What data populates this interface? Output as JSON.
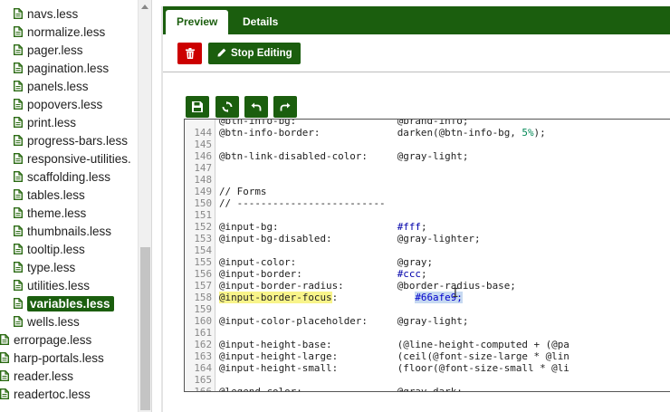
{
  "sidebar": {
    "files": [
      {
        "name": "navs.less",
        "indent": true
      },
      {
        "name": "normalize.less",
        "indent": true
      },
      {
        "name": "pager.less",
        "indent": true
      },
      {
        "name": "pagination.less",
        "indent": true
      },
      {
        "name": "panels.less",
        "indent": true
      },
      {
        "name": "popovers.less",
        "indent": true
      },
      {
        "name": "print.less",
        "indent": true
      },
      {
        "name": "progress-bars.less",
        "indent": true
      },
      {
        "name": "responsive-utilities.",
        "indent": true
      },
      {
        "name": "scaffolding.less",
        "indent": true
      },
      {
        "name": "tables.less",
        "indent": true
      },
      {
        "name": "theme.less",
        "indent": true
      },
      {
        "name": "thumbnails.less",
        "indent": true
      },
      {
        "name": "tooltip.less",
        "indent": true
      },
      {
        "name": "type.less",
        "indent": true
      },
      {
        "name": "utilities.less",
        "indent": true
      },
      {
        "name": "variables.less",
        "indent": true,
        "active": true
      },
      {
        "name": "wells.less",
        "indent": true
      },
      {
        "name": "errorpage.less",
        "indent": false
      },
      {
        "name": "harp-portals.less",
        "indent": false
      },
      {
        "name": "reader.less",
        "indent": false
      },
      {
        "name": "readertoc.less",
        "indent": false
      }
    ]
  },
  "tabs": {
    "preview": "Preview",
    "details": "Details"
  },
  "toolbar": {
    "stop_editing": "Stop Editing"
  },
  "editor": {
    "lines": [
      {
        "n": "",
        "code": "@btn-info-bg:                 @brand-info;"
      },
      {
        "n": "144",
        "code": "@btn-info-border:             darken(@btn-info-bg, 5%);"
      },
      {
        "n": "145",
        "code": ""
      },
      {
        "n": "146",
        "code": "@btn-link-disabled-color:     @gray-light;"
      },
      {
        "n": "147",
        "code": ""
      },
      {
        "n": "148",
        "code": ""
      },
      {
        "n": "149",
        "code": "// Forms"
      },
      {
        "n": "150",
        "code": "// -------------------------"
      },
      {
        "n": "151",
        "code": ""
      },
      {
        "n": "152",
        "code": "@input-bg:                    #fff;"
      },
      {
        "n": "153",
        "code": "@input-bg-disabled:           @gray-lighter;"
      },
      {
        "n": "154",
        "code": ""
      },
      {
        "n": "155",
        "code": "@input-color:                 @gray;"
      },
      {
        "n": "156",
        "code": "@input-border:                #ccc;"
      },
      {
        "n": "157",
        "code": "@input-border-radius:         @border-radius-base;"
      },
      {
        "n": "158",
        "code_hl": "@input-border-focus",
        "code_mid": ":             ",
        "code_sel": "#66afe9;"
      },
      {
        "n": "159",
        "code": ""
      },
      {
        "n": "160",
        "code": "@input-color-placeholder:     @gray-light;"
      },
      {
        "n": "161",
        "code": ""
      },
      {
        "n": "162",
        "code": "@input-height-base:           (@line-height-computed + (@pa"
      },
      {
        "n": "163",
        "code": "@input-height-large:          (ceil(@font-size-large * @lin"
      },
      {
        "n": "164",
        "code": "@input-height-small:          (floor(@font-size-small * @li"
      },
      {
        "n": "165",
        "code": ""
      },
      {
        "n": "166",
        "code": "@legend-color:                @gray-dark;"
      }
    ]
  },
  "colors": {
    "brand_green": "#1b5e0e",
    "delete_red": "#cc0000",
    "highlight_yellow": "#f8f48a",
    "selection_blue": "#c6d9f1"
  }
}
